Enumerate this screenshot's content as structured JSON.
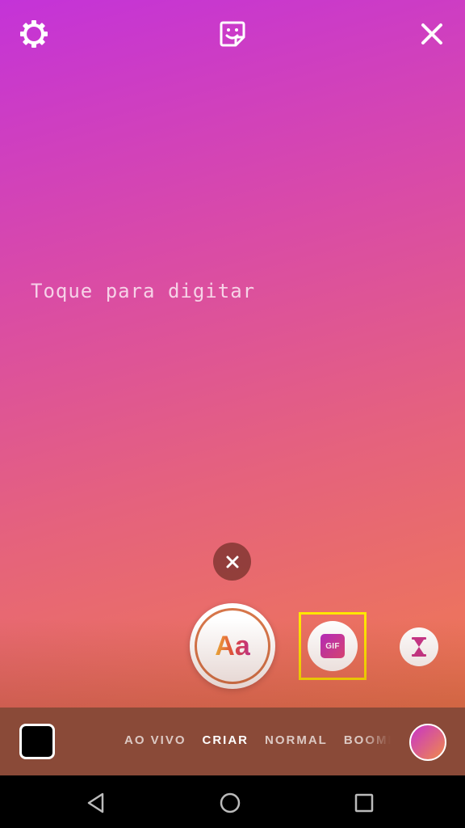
{
  "canvas": {
    "prompt": "Toque para digitar"
  },
  "top_bar": {
    "settings_icon": "gear-icon",
    "sticker_icon": "sticker-icon",
    "close_icon": "close-icon"
  },
  "create_tools": {
    "shutter_label": "Aa",
    "gif_label": "GIF",
    "timer_icon": "hourglass-icon",
    "dismiss_icon": "close-icon"
  },
  "modes": {
    "items": [
      "AO VIVO",
      "CRIAR",
      "NORMAL",
      "BOOMERANG"
    ],
    "active": "CRIAR"
  },
  "colors": {
    "highlight": "#ffe600",
    "gradient_top": "#c433d8",
    "gradient_bottom": "#ef7a52",
    "mode_bar": "#8a4a38"
  },
  "nav": {
    "back_icon": "back-triangle-icon",
    "home_icon": "home-circle-icon",
    "recents_icon": "recents-square-icon"
  }
}
